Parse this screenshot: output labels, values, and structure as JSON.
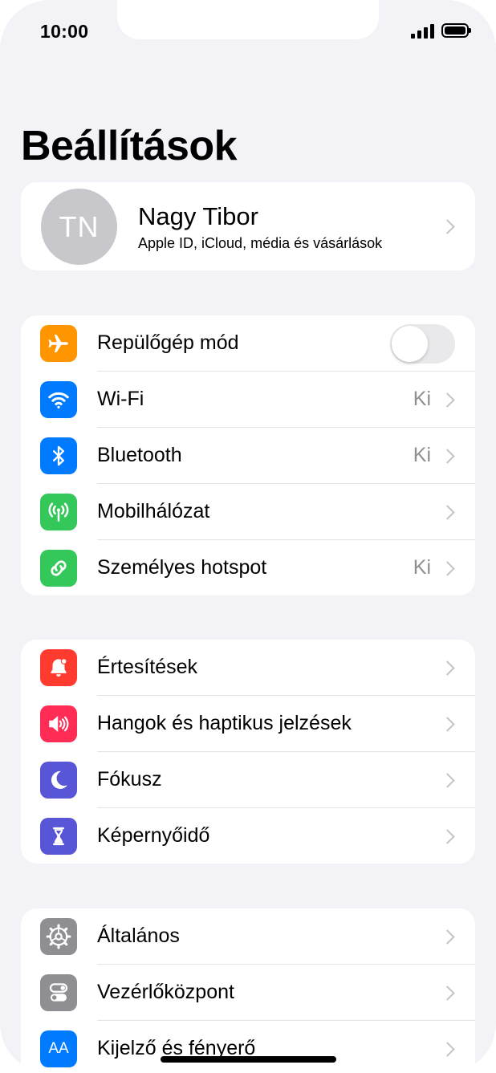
{
  "status_bar": {
    "time": "10:00"
  },
  "header": {
    "title": "Beállítások"
  },
  "profile": {
    "initials": "TN",
    "name": "Nagy Tibor",
    "subtitle": "Apple ID, iCloud, média és vásárlások"
  },
  "connectivity": {
    "airplane": {
      "label": "Repülőgép mód",
      "icon": "airplane-icon",
      "color": "#ff9500",
      "toggle_on": false
    },
    "wifi": {
      "label": "Wi-Fi",
      "value": "Ki",
      "icon": "wifi-icon",
      "color": "#007aff"
    },
    "bluetooth": {
      "label": "Bluetooth",
      "value": "Ki",
      "icon": "bluetooth-icon",
      "color": "#007aff"
    },
    "cellular": {
      "label": "Mobilhálózat",
      "icon": "antenna-icon",
      "color": "#34c759"
    },
    "hotspot": {
      "label": "Személyes hotspot",
      "value": "Ki",
      "icon": "hotspot-chain-icon",
      "color": "#34c759"
    }
  },
  "attention": {
    "notifications": {
      "label": "Értesítések",
      "icon": "bell-icon",
      "color": "#ff3b30"
    },
    "sounds": {
      "label": "Hangok és haptikus jelzések",
      "icon": "speaker-icon",
      "color": "#ff2d55"
    },
    "focus": {
      "label": "Fókusz",
      "icon": "moon-icon",
      "color": "#5856d6"
    },
    "screen_time": {
      "label": "Képernyőidő",
      "icon": "hourglass-icon",
      "color": "#5856d6"
    }
  },
  "system": {
    "general": {
      "label": "Általános",
      "icon": "gear-icon",
      "color": "#8e8e93"
    },
    "control_center": {
      "label": "Vezérlőközpont",
      "icon": "switches-icon",
      "color": "#8e8e93"
    },
    "display": {
      "label": "Kijelző és fényerő",
      "icon": "text-size-icon",
      "icon_text": "AA",
      "color": "#007aff"
    }
  }
}
